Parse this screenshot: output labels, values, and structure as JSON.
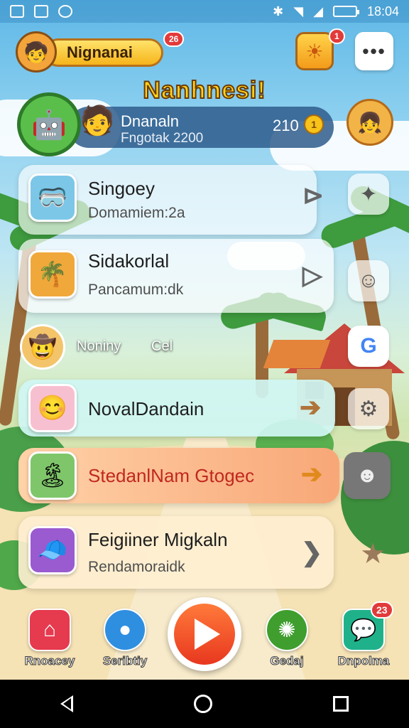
{
  "status_bar": {
    "time": "18:04",
    "icons": [
      "image-icon",
      "photo-icon",
      "alert-icon",
      "bluetooth-icon",
      "wifi-icon",
      "signal-icon",
      "battery-icon"
    ]
  },
  "header": {
    "profile_name": "Nignanai",
    "profile_badge": "26",
    "sun_badge": "1",
    "more_label": "•••",
    "app_title": "Nanhnesi!"
  },
  "player": {
    "name": "Dnanaln",
    "subtitle": "Fngotak 2200",
    "coins": "210"
  },
  "cards": [
    {
      "title": "Singoey",
      "subtitle": "Domamiem:2a",
      "thumb_icon": "goggles-kid-icon",
      "side_icon": "puzzle-icon"
    },
    {
      "title": "Sidakorlal",
      "subtitle": "Pancamum:dk",
      "thumb_icon": "jungle-kid-icon",
      "side_icon": "face-icon"
    },
    {
      "title": "NovalDandain",
      "subtitle": "",
      "thumb_icon": "robot-face-icon",
      "side_icon": "gear-icon"
    },
    {
      "title": "StedanlNam Gtogec",
      "subtitle": "",
      "thumb_icon": "island-scene-icon",
      "side_icon": "character-icon"
    },
    {
      "title": "Feigiiner Migkaln",
      "subtitle": "Rendamoraidk",
      "thumb_icon": "explorer-kid-icon",
      "side_icon": "star-icon"
    }
  ],
  "friend": {
    "name": "Noniny",
    "status": "Cel"
  },
  "dock": [
    {
      "label": "Rnoacey",
      "color": "#e63a4f",
      "icon": "home-icon"
    },
    {
      "label": "Seribtiy",
      "color": "#2e8fe0",
      "icon": "orb-icon"
    },
    {
      "label": "Gedaj",
      "color": "#3f9e2e",
      "icon": "virus-icon"
    },
    {
      "label": "Dnpolma",
      "color": "#1fb28a",
      "icon": "chat-icon",
      "badge": "23"
    }
  ]
}
